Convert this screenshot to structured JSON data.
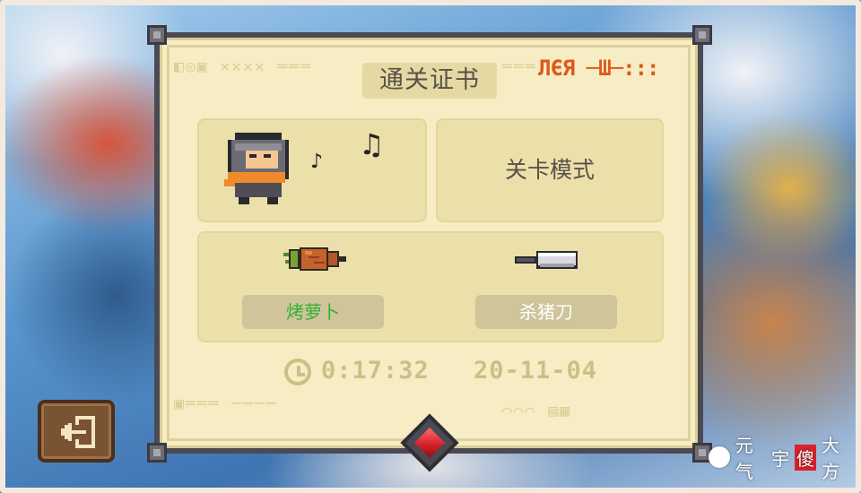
{
  "certificate": {
    "title": "通关证书",
    "stamp_text": "ЛЄЯ ─Ш─:::"
  },
  "character": {
    "name": "knight",
    "icon": "knight-icon",
    "note_small": "♪",
    "note_large": "♫"
  },
  "mode": {
    "label": "关卡模式"
  },
  "items": [
    {
      "icon": "carrot-icon",
      "label": "烤萝卜",
      "label_color": "#35b234"
    },
    {
      "icon": "knife-icon",
      "label": "杀猪刀",
      "label_color": "#ffffff"
    }
  ],
  "stats": {
    "time": "0:17:32",
    "date": "20-11-04"
  },
  "controls": {
    "exit_icon": "exit-door-icon"
  },
  "watermark": {
    "prefix": "元气",
    "middle": "宇",
    "highlight": "傻",
    "suffix": "大方"
  },
  "colors": {
    "card_background": "#f6edc4",
    "card_border": "#4b4a52",
    "stamp": "#e0581c",
    "gem": "#d4232a"
  }
}
